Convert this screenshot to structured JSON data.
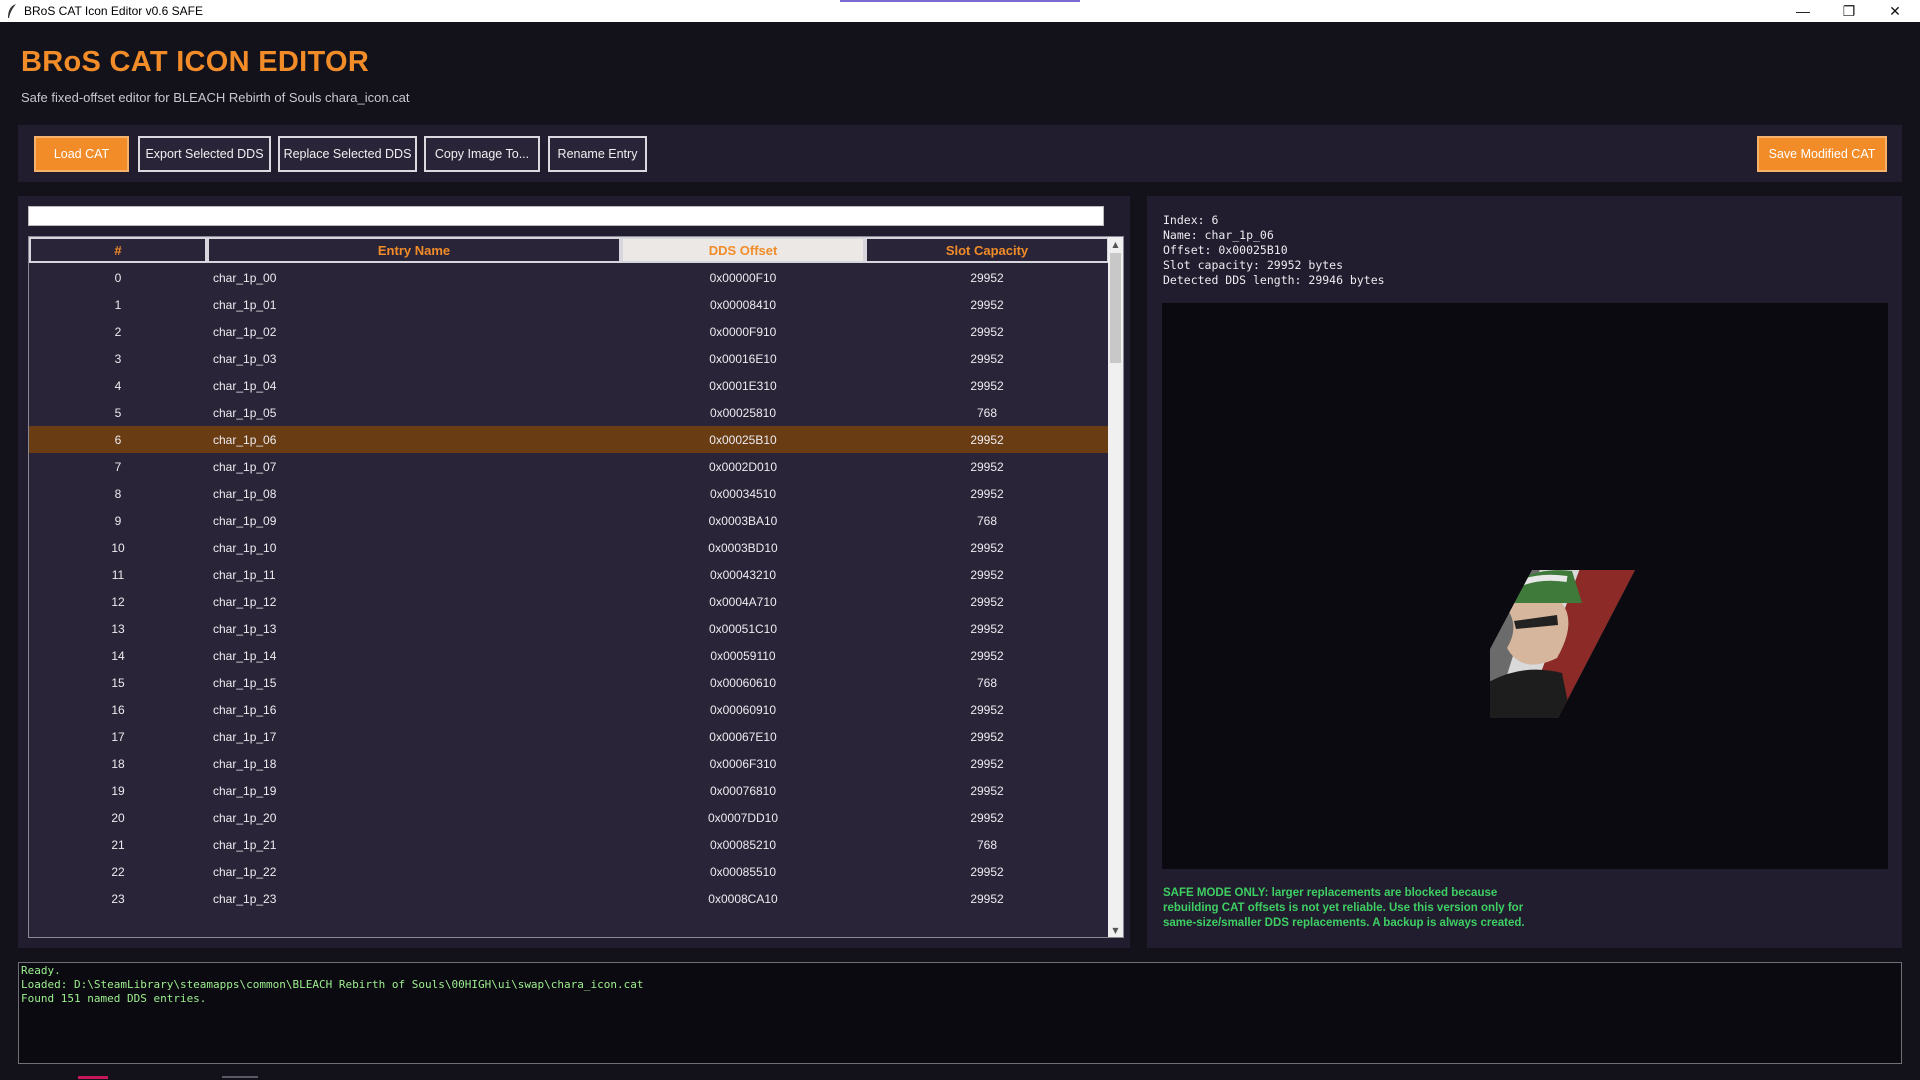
{
  "window": {
    "title": "BRoS CAT Icon Editor v0.6 SAFE"
  },
  "header": {
    "title": "BRoS CAT ICON EDITOR",
    "subtitle": "Safe fixed-offset editor for BLEACH Rebirth of Souls chara_icon.cat"
  },
  "toolbar": {
    "load": "Load CAT",
    "export": "Export Selected DDS",
    "replace": "Replace Selected DDS",
    "copy": "Copy Image To...",
    "rename": "Rename Entry",
    "save": "Save Modified CAT"
  },
  "search": {
    "value": "",
    "placeholder": ""
  },
  "table": {
    "headers": [
      "#",
      "Entry Name",
      "DDS Offset",
      "Slot Capacity"
    ],
    "sorted_column": "DDS Offset",
    "selected_index": 6,
    "rows": [
      [
        "0",
        "char_1p_00",
        "0x00000F10",
        "29952"
      ],
      [
        "1",
        "char_1p_01",
        "0x00008410",
        "29952"
      ],
      [
        "2",
        "char_1p_02",
        "0x0000F910",
        "29952"
      ],
      [
        "3",
        "char_1p_03",
        "0x00016E10",
        "29952"
      ],
      [
        "4",
        "char_1p_04",
        "0x0001E310",
        "29952"
      ],
      [
        "5",
        "char_1p_05",
        "0x00025810",
        "768"
      ],
      [
        "6",
        "char_1p_06",
        "0x00025B10",
        "29952"
      ],
      [
        "7",
        "char_1p_07",
        "0x0002D010",
        "29952"
      ],
      [
        "8",
        "char_1p_08",
        "0x00034510",
        "29952"
      ],
      [
        "9",
        "char_1p_09",
        "0x0003BA10",
        "768"
      ],
      [
        "10",
        "char_1p_10",
        "0x0003BD10",
        "29952"
      ],
      [
        "11",
        "char_1p_11",
        "0x00043210",
        "29952"
      ],
      [
        "12",
        "char_1p_12",
        "0x0004A710",
        "29952"
      ],
      [
        "13",
        "char_1p_13",
        "0x00051C10",
        "29952"
      ],
      [
        "14",
        "char_1p_14",
        "0x00059110",
        "29952"
      ],
      [
        "15",
        "char_1p_15",
        "0x00060610",
        "768"
      ],
      [
        "16",
        "char_1p_16",
        "0x00060910",
        "29952"
      ],
      [
        "17",
        "char_1p_17",
        "0x00067E10",
        "29952"
      ],
      [
        "18",
        "char_1p_18",
        "0x0006F310",
        "29952"
      ],
      [
        "19",
        "char_1p_19",
        "0x00076810",
        "29952"
      ],
      [
        "20",
        "char_1p_20",
        "0x0007DD10",
        "29952"
      ],
      [
        "21",
        "char_1p_21",
        "0x00085210",
        "768"
      ],
      [
        "22",
        "char_1p_22",
        "0x00085510",
        "29952"
      ],
      [
        "23",
        "char_1p_23",
        "0x0008CA10",
        "29952"
      ]
    ]
  },
  "details": {
    "index": "Index: 6",
    "name": "Name: char_1p_06",
    "offset": "Offset: 0x00025B10",
    "capacity": "Slot capacity: 29952 bytes",
    "detected": "Detected DDS length: 29946 bytes"
  },
  "safe_note": "SAFE MODE ONLY: larger replacements are blocked because rebuilding CAT offsets is not yet reliable. Use this version only for same-size/smaller DDS replacements. A backup is always created.",
  "log": [
    "Ready.",
    "Loaded: D:\\SteamLibrary\\steamapps\\common\\BLEACH Rebirth of Souls\\00HIGH\\ui\\swap\\chara_icon.cat",
    "Found 151 named DDS entries."
  ],
  "colors": {
    "accent": "#f28c28",
    "background": "#13121b",
    "panel": "#211c2e",
    "selected_row": "#6a3c14",
    "log_text": "#9df08f",
    "safe_text": "#3ecf63"
  },
  "icons": {
    "app": "feather-icon",
    "minimize": "minimize-icon",
    "restore": "restore-icon",
    "close": "close-icon"
  }
}
